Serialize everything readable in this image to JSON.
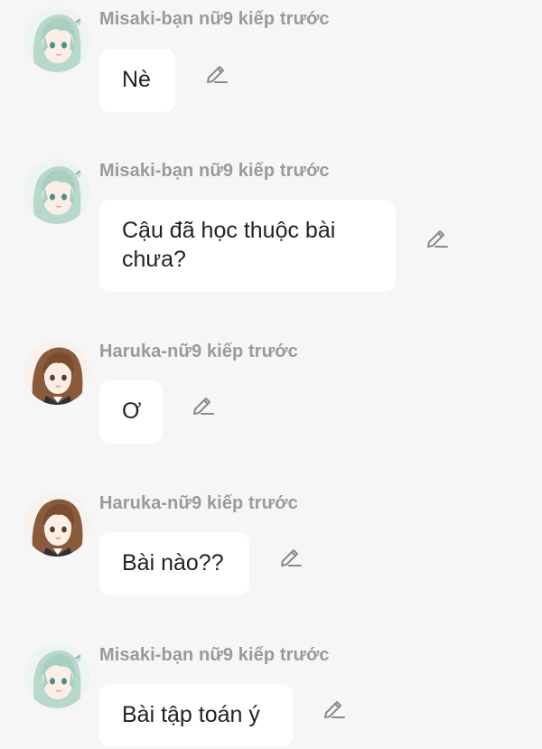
{
  "messages": [
    {
      "sender": "Misaki-bạn nữ9 kiếp trước",
      "avatar": "misaki-avatar",
      "text": "Nè"
    },
    {
      "sender": "Misaki-bạn nữ9 kiếp trước",
      "avatar": "misaki-avatar",
      "text": "Cậu đã học thuộc bài chưa?"
    },
    {
      "sender": "Haruka-nữ9 kiếp trước",
      "avatar": "haruka-avatar",
      "text": "Ơ"
    },
    {
      "sender": "Haruka-nữ9 kiếp trước",
      "avatar": "haruka-avatar",
      "text": "Bài nào??"
    },
    {
      "sender": "Misaki-bạn nữ9 kiếp trước",
      "avatar": "misaki-avatar",
      "text": "Bài tập toán ý"
    }
  ],
  "icons": {
    "edit": "pencil-edit-icon"
  },
  "colors": {
    "background": "#f6f6f6",
    "bubble": "#ffffff",
    "sender_text": "#9a9a9a",
    "message_text": "#222222",
    "icon": "#8a8a8a"
  }
}
